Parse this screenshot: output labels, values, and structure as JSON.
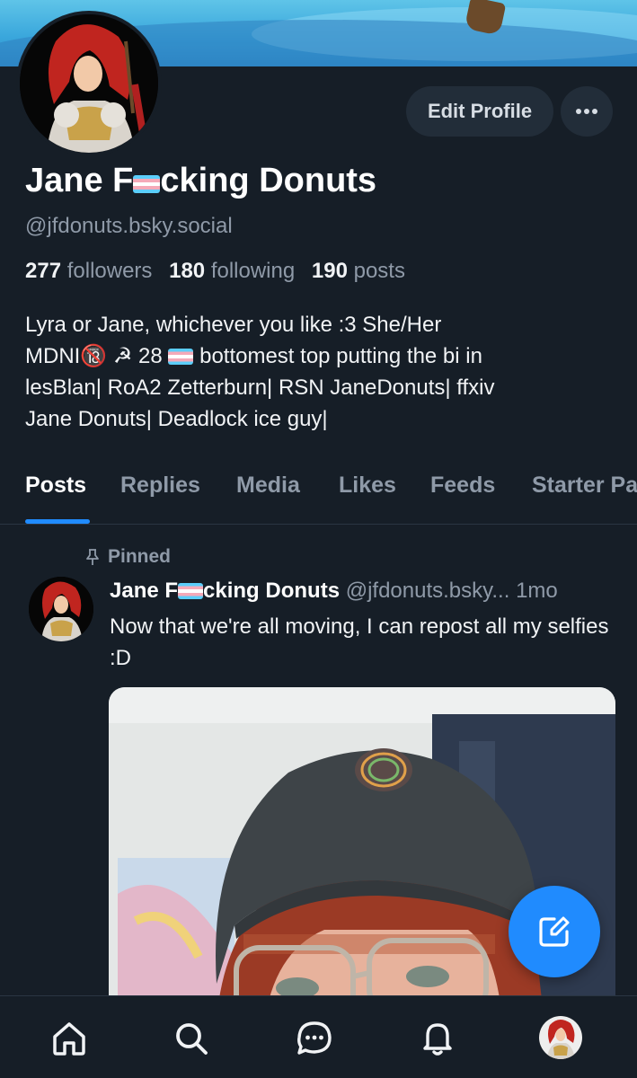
{
  "profile": {
    "display_name_part1": "Jane F",
    "display_name_part2": "cking Donuts",
    "handle": "@jfdonuts.bsky.social",
    "edit_label": "Edit Profile",
    "more_label": "•••",
    "stats": {
      "followers_count": "277",
      "followers_label": "followers",
      "following_count": "180",
      "following_label": "following",
      "posts_count": "190",
      "posts_label": "posts"
    },
    "bio": {
      "line1": "Lyra or Jane, whichever you like :3 She/Her",
      "line2_a": "MDNI🔞 ☭ 28 ",
      "line2_b": " bottomest top putting the bi in",
      "line3": "lesBlan| RoA2 Zetterburn| RSN JaneDonuts| ffxiv",
      "line4": "Jane Donuts| Deadlock ice guy|"
    }
  },
  "tabs": [
    {
      "label": "Posts",
      "active": true
    },
    {
      "label": "Replies",
      "active": false
    },
    {
      "label": "Media",
      "active": false
    },
    {
      "label": "Likes",
      "active": false
    },
    {
      "label": "Feeds",
      "active": false
    },
    {
      "label": "Starter Pa",
      "active": false
    }
  ],
  "post": {
    "pinned_label": "Pinned",
    "author_part1": "Jane F",
    "author_part2": "cking Donuts",
    "handle": "@jfdonuts.bsky...",
    "time": "1mo",
    "text": "Now that we're all moving, I can repost all my selfies :D"
  },
  "nav": {
    "items": [
      "home-icon",
      "search-icon",
      "chat-icon",
      "bell-icon",
      "profile-avatar"
    ]
  },
  "colors": {
    "background": "#161e27",
    "accent": "#208bfe",
    "muted": "#8f9aa8",
    "button_bg": "#222d39"
  }
}
